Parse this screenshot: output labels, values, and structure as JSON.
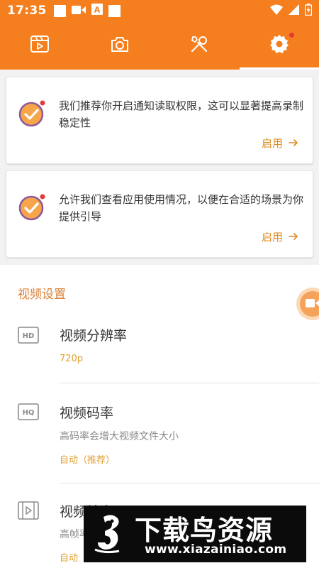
{
  "status_bar": {
    "time": "17:35"
  },
  "tabs": [
    {
      "id": "recordings",
      "icon": "video-clip-icon"
    },
    {
      "id": "screenshot",
      "icon": "camera-icon"
    },
    {
      "id": "tools",
      "icon": "tools-icon"
    },
    {
      "id": "settings",
      "icon": "gear-icon",
      "active": true
    }
  ],
  "permission_cards": [
    {
      "text": "我们推荐你开启通知读取权限，这可以显著提高录制稳定性",
      "action": "启用"
    },
    {
      "text": "允许我们查看应用使用情况，以便在合适的场景为你提供引导",
      "action": "启用"
    }
  ],
  "video_settings": {
    "section_title": "视频设置",
    "items": [
      {
        "icon": "HD",
        "title": "视频分辨率",
        "value": "720p"
      },
      {
        "icon": "HQ",
        "title": "视频码率",
        "description": "高码率会增大视频文件大小",
        "value": "自动（推荐）"
      },
      {
        "icon": "film-icon",
        "title": "视频帧率",
        "description": "高帧率",
        "value": "自动"
      }
    ]
  },
  "watermark": {
    "title": "下载鸟资源",
    "url": "www.xiazainiao.com"
  },
  "colors": {
    "accent": "#f57f1f",
    "link": "#e08a1e",
    "section": "#d9823a",
    "value": "#e0a030"
  }
}
